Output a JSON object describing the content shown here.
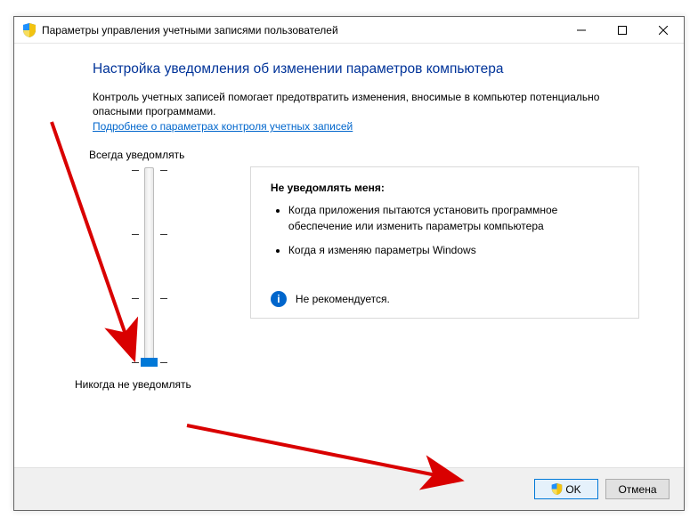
{
  "window": {
    "title": "Параметры управления учетными записями пользователей"
  },
  "heading": "Настройка уведомления об изменении параметров компьютера",
  "desc": "Контроль учетных записей помогает предотвратить изменения, вносимые в компьютер потенциально опасными программами.",
  "link": "Подробнее о параметрах контроля учетных записей",
  "slider": {
    "top_label": "Всегда уведомлять",
    "bottom_label": "Никогда не уведомлять",
    "positions": 4,
    "current_position": 0
  },
  "panel": {
    "title": "Не уведомлять меня:",
    "bullets": [
      "Когда приложения пытаются установить программное обеспечение или изменить параметры компьютера",
      "Когда я изменяю параметры Windows"
    ],
    "recommendation": "Не рекомендуется."
  },
  "buttons": {
    "ok": "OK",
    "cancel": "Отмена"
  }
}
